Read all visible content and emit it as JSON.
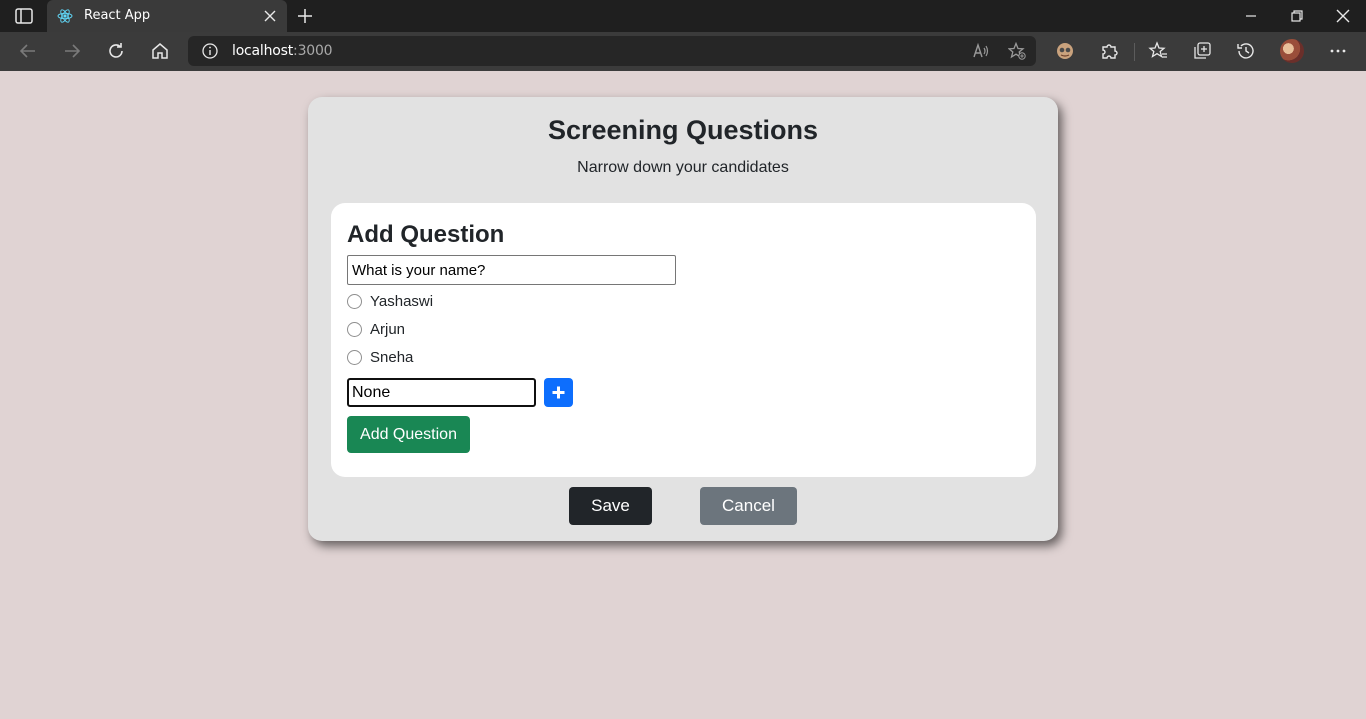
{
  "browser": {
    "tab_title": "React App",
    "address_host": "localhost",
    "address_port": ":3000",
    "icons": [
      "tab-actions-icon",
      "react-favicon-icon",
      "close-icon",
      "new-tab-icon",
      "back-icon",
      "forward-icon",
      "refresh-icon",
      "home-icon",
      "info-icon",
      "read-aloud-icon",
      "add-favorite-icon",
      "extension-profile-icon",
      "extensions-icon",
      "favorites-icon",
      "collections-icon",
      "history-icon",
      "avatar",
      "more-icon",
      "minimize-icon",
      "restore-icon",
      "window-close-icon"
    ]
  },
  "page": {
    "title": "Screening Questions",
    "subtitle": "Narrow down your candidates",
    "form": {
      "heading": "Add Question",
      "question_value": "What is your name?",
      "options": [
        {
          "label": "Yashaswi"
        },
        {
          "label": "Arjun"
        },
        {
          "label": "Sneha"
        }
      ],
      "new_option_value": "None",
      "add_option_icon": "plus-icon",
      "add_question_label": "Add Question"
    },
    "save_label": "Save",
    "cancel_label": "Cancel"
  },
  "colors": {
    "page_background": "#e0d3d3",
    "card_background": "#e2e2e2",
    "primary_blue": "#0d6efd",
    "success_green": "#198754",
    "dark_button": "#212529",
    "secondary_button": "#6c757d"
  }
}
